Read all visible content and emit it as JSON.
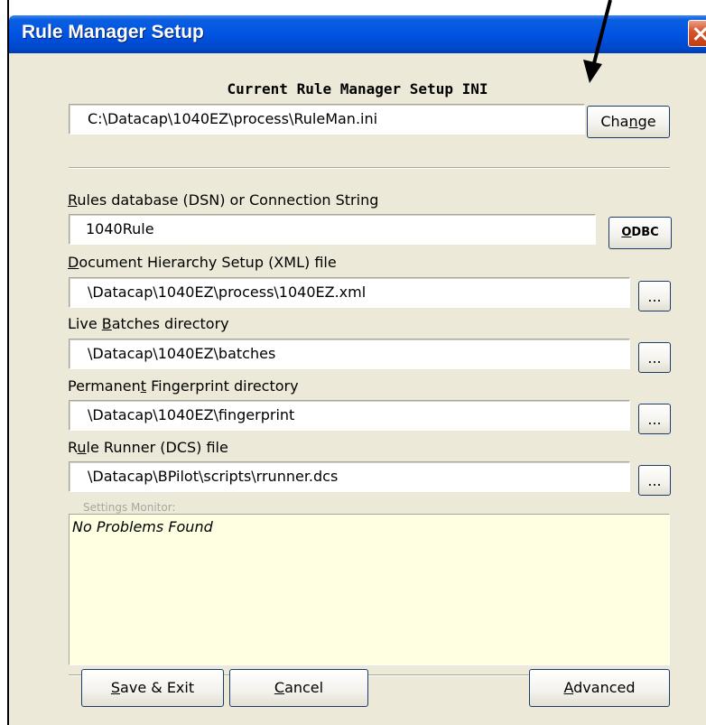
{
  "window": {
    "title": "Rule Manager Setup"
  },
  "ini": {
    "heading": "Current Rule Manager Setup INI",
    "path": "C:\\Datacap\\1040EZ\\process\\RuleMan.ini",
    "change_pre": "Cha",
    "change_mn": "n",
    "change_post": "ge"
  },
  "dsn": {
    "label_mn": "R",
    "label_rest": "ules database (DSN) or Connection String",
    "value": "1040Rule",
    "odbc_mn": "O",
    "odbc_rest": "DBC"
  },
  "hierarchy": {
    "label_mn": "D",
    "label_rest": "ocument Hierarchy Setup (XML) file",
    "value": "\\Datacap\\1040EZ\\process\\1040EZ.xml",
    "browse": "..."
  },
  "batches": {
    "label_pre": "Live ",
    "label_mn": "B",
    "label_post": "atches directory",
    "value": "\\Datacap\\1040EZ\\batches",
    "browse": "..."
  },
  "fingerprint": {
    "label_pre": "Permanen",
    "label_mn": "t",
    "label_post": " Fingerprint directory",
    "value": "\\Datacap\\1040EZ\\fingerprint",
    "browse": "..."
  },
  "runner": {
    "label_pre": "R",
    "label_mn": "u",
    "label_post": "le Runner (DCS) file",
    "value": "\\Datacap\\BPilot\\scripts\\rrunner.dcs",
    "browse": "..."
  },
  "monitor": {
    "legend": "Settings Monitor:",
    "message": "No Problems Found"
  },
  "buttons": {
    "save_mn": "S",
    "save_rest": "ave & Exit",
    "cancel_mn": "C",
    "cancel_rest": "ancel",
    "advanced_mn": "A",
    "advanced_rest": "dvanced"
  },
  "colors": {
    "titlebar": "#0054e3",
    "dialog_bg": "#ece9d8",
    "monitor_bg": "#ffffe1",
    "annotation_arrow": "#000000"
  }
}
